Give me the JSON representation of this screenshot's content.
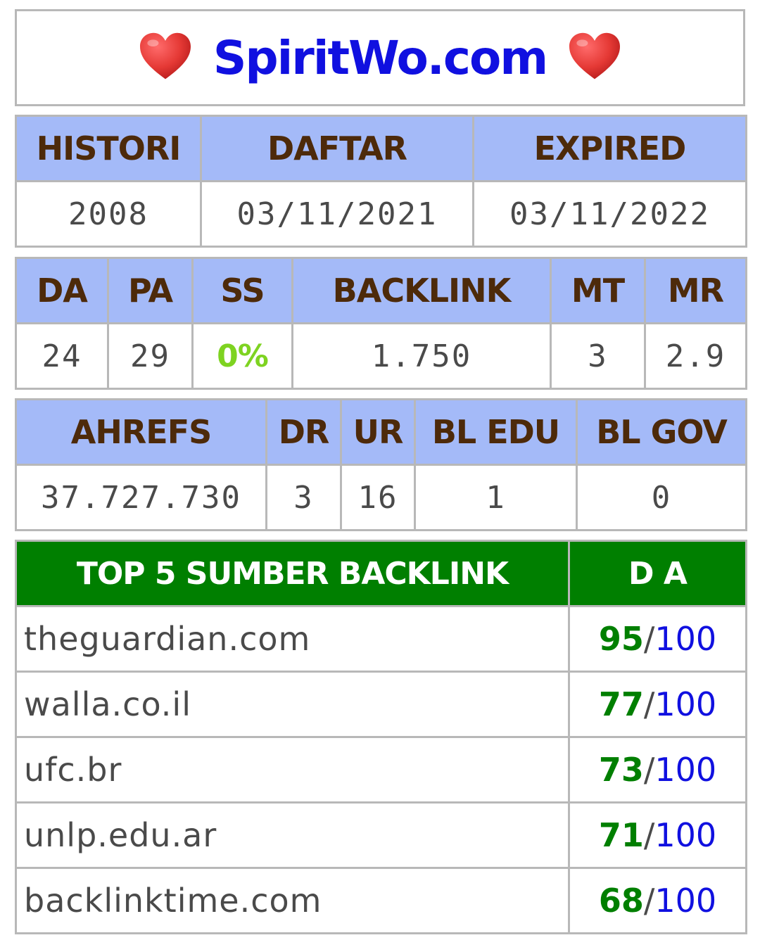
{
  "header": {
    "site": "SpiritWo.com",
    "left_icon": "heart-icon",
    "right_icon": "heart-icon",
    "heart_color": "#e53935"
  },
  "registration": {
    "headers": [
      "HISTORI",
      "DAFTAR",
      "EXPIRED"
    ],
    "values": [
      "2008",
      "03/11/2021",
      "03/11/2022"
    ]
  },
  "moz": {
    "headers": [
      "DA",
      "PA",
      "SS",
      "BACKLINK",
      "MT",
      "MR"
    ],
    "values": [
      "24",
      "29",
      "0%",
      "1.750",
      "3",
      "2.9"
    ]
  },
  "ahrefs": {
    "headers": [
      "AHREFS",
      "DR",
      "UR",
      "BL EDU",
      "BL GOV"
    ],
    "values": [
      "37.727.730",
      "3",
      "16",
      "1",
      "0"
    ]
  },
  "backlinks": {
    "header_source": "TOP 5 SUMBER BACKLINK",
    "header_da": "D A",
    "slash": "/",
    "rows": [
      {
        "domain": "theguardian.com",
        "da": "95",
        "max": "100"
      },
      {
        "domain": "walla.co.il",
        "da": "77",
        "max": "100"
      },
      {
        "domain": "ufc.br",
        "da": "73",
        "max": "100"
      },
      {
        "domain": "unlp.edu.ar",
        "da": "71",
        "max": "100"
      },
      {
        "domain": "backlinktime.com",
        "da": "68",
        "max": "100"
      }
    ]
  },
  "colors": {
    "header_bg": "#a4baf8",
    "header_text": "#4d2a0a",
    "green_header_bg": "#007f00",
    "title_blue": "#1010e0",
    "ss_green": "#7ed321"
  }
}
